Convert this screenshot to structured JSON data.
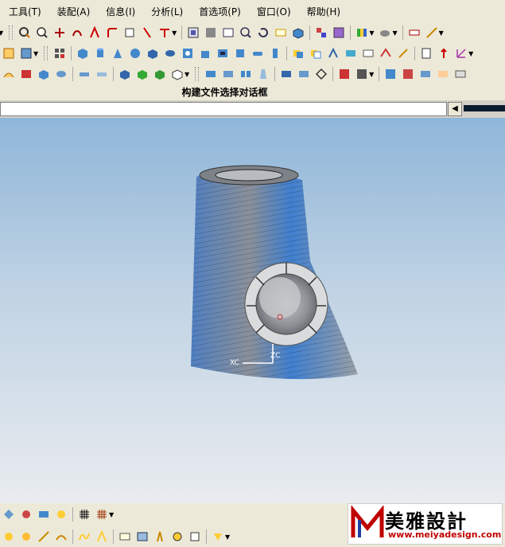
{
  "menu": [
    {
      "label": "工具(T)"
    },
    {
      "label": "装配(A)"
    },
    {
      "label": "信息(I)"
    },
    {
      "label": "分析(L)"
    },
    {
      "label": "首选项(P)"
    },
    {
      "label": "窗口(O)"
    },
    {
      "label": "帮助(H)"
    }
  ],
  "cue_line": {
    "text": "构建文件选择对话框"
  },
  "viewport": {
    "triad_x_label": "XC",
    "triad_y_label": "ZC"
  },
  "watermark": {
    "title": "美雅設計",
    "url": "www.meiyadesign.com"
  },
  "colors": {
    "accent_blue": "#2f6fd6",
    "toolbar_bg": "#ece9d8",
    "model_gray": "#9aa0a7",
    "model_blue": "#3f7fd0"
  },
  "icons": {
    "collapse": "chevron-left-icon"
  }
}
